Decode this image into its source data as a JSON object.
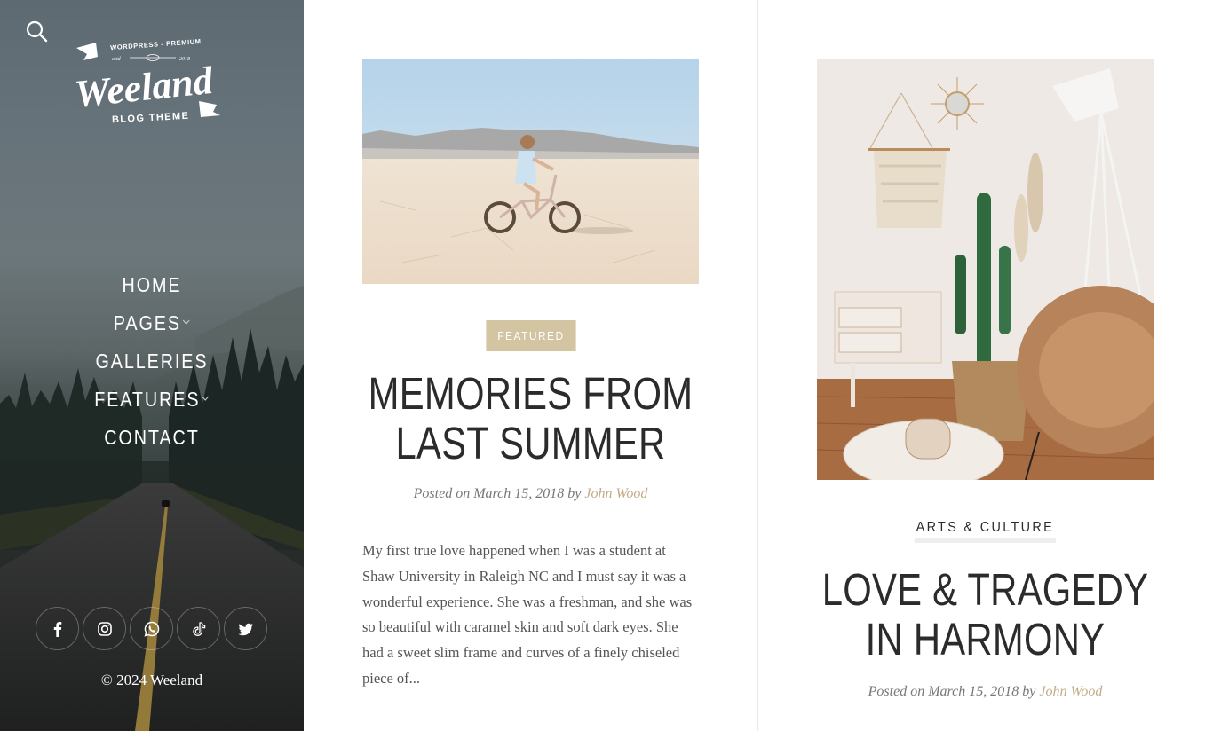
{
  "sidebar": {
    "logo": {
      "top_line": "WORDPRESS - PREMIUM",
      "estd": "estd",
      "year": "2018",
      "name": "Weeland",
      "subtitle": "BLOG THEME"
    },
    "search_icon": "search-icon",
    "nav": [
      {
        "label": "HOME",
        "has_submenu": false
      },
      {
        "label": "PAGES",
        "has_submenu": true
      },
      {
        "label": "GALLERIES",
        "has_submenu": false
      },
      {
        "label": "FEATURES",
        "has_submenu": true
      },
      {
        "label": "CONTACT",
        "has_submenu": false
      }
    ],
    "socials": [
      {
        "name": "facebook",
        "icon": "facebook-icon"
      },
      {
        "name": "instagram",
        "icon": "instagram-icon"
      },
      {
        "name": "whatsapp",
        "icon": "whatsapp-icon"
      },
      {
        "name": "tiktok",
        "icon": "tiktok-icon"
      },
      {
        "name": "twitter",
        "icon": "twitter-icon"
      }
    ],
    "copyright": "© 2024 Weeland"
  },
  "posts": [
    {
      "image_alt": "Girl riding a bicycle on a desert salt flat",
      "category": "FEATURED",
      "title": "MEMORIES FROM LAST SUMMER",
      "meta_prefix": "Posted on March 15, 2018 by ",
      "author": "John Wood",
      "excerpt": "My first true love happened when I was a student at Shaw University in Raleigh NC and I must say it was a wonderful experience. She was a freshman, and she was so beautiful with caramel skin and soft dark eyes. She had a sweet slim frame and curves of a finely chiseled piece of..."
    },
    {
      "image_alt": "Boho interior with cactus, macrame wall hanging and rattan chair",
      "category": "ARTS & CULTURE",
      "title": "LOVE & TRAGEDY IN HARMONY",
      "meta_prefix": "Posted on March 15, 2018 by ",
      "author": "John Wood"
    }
  ],
  "colors": {
    "accent": "#c2ab85",
    "featured_badge": "#d3c4a2",
    "heading": "#2b2b2b",
    "body_text": "#555555"
  }
}
